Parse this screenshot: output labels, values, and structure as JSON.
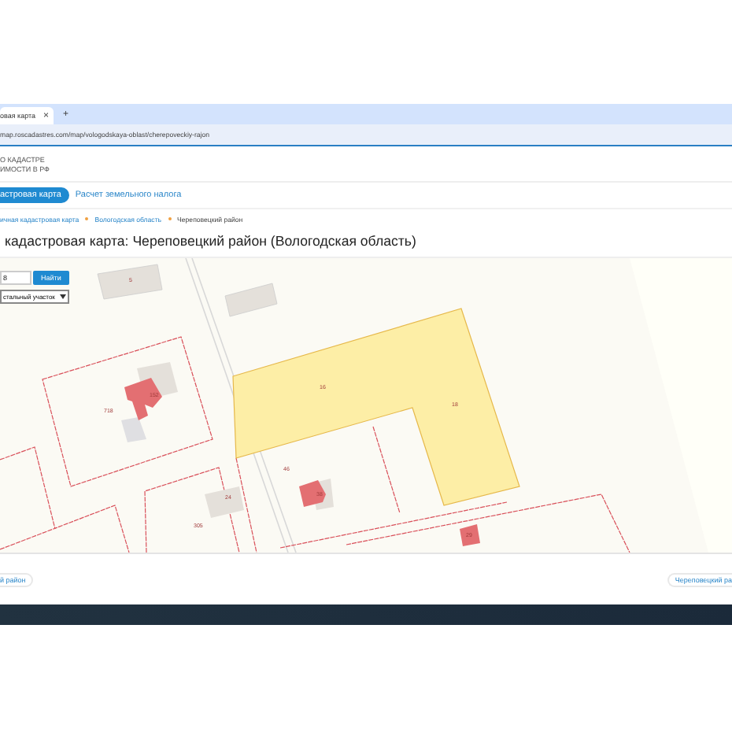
{
  "browser": {
    "tab": {
      "title": "овая карта",
      "close": "×",
      "selected": true
    },
    "new_tab": "+",
    "url": "map.roscadastres.com/map/vologodskaya-oblast/cherepoveckiy-rajon"
  },
  "site": {
    "logo_lines": [
      "О КАДАСТРЕ",
      "ИМОСТИ В РФ"
    ],
    "nav": [
      {
        "label": "астровая карта",
        "selected": true
      },
      {
        "label": "Расчет земельного налога",
        "selected": false
      }
    ],
    "breadcrumbs": [
      "ичная кадастровая карта",
      "Вологодская область",
      "Череповецкий район"
    ],
    "heading": "кадастровая карта: Череповецкий район (Вологодская область)"
  },
  "map": {
    "search": {
      "value": "8",
      "button": "Найти",
      "select": "стальный участок"
    },
    "labels": [
      "5",
      "718",
      "152",
      "24",
      "305",
      "46",
      "38",
      "16",
      "18",
      "29"
    ]
  },
  "footer": {
    "links": [
      "й район",
      "Череповецкий ра"
    ]
  }
}
